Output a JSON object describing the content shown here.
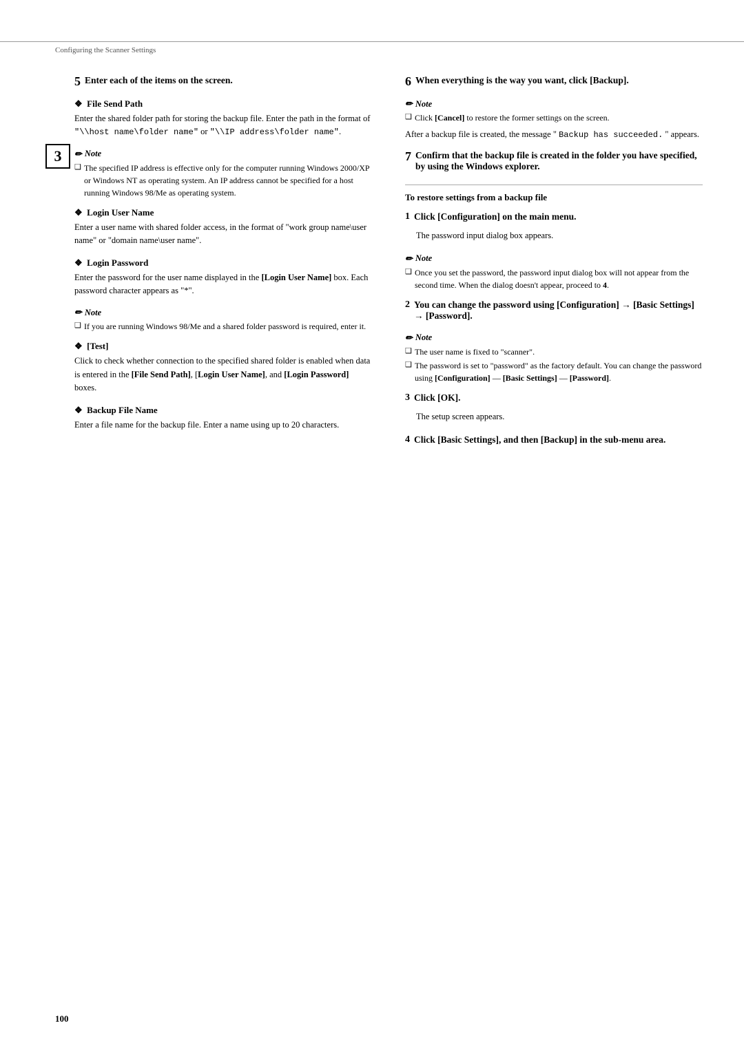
{
  "header": {
    "text": "Configuring the Scanner Settings"
  },
  "sidebar": {
    "chapter": "3"
  },
  "left_column": {
    "step5": {
      "label": "5",
      "text": "Enter each of the items on the screen."
    },
    "file_send_path": {
      "title": "❖  File Send Path",
      "body": "Enter the shared folder path for storing the backup file. Enter the path in the format of \"\\\\host name\\folder name\" or \"\\\\IP address\\folder name\"."
    },
    "note1": {
      "title": "Note",
      "item1": "The specified IP address is effective only for the computer running Windows 2000/XP or Windows NT as operating system. An IP address cannot be specified for a host running Windows 98/Me as operating system."
    },
    "login_user_name": {
      "title": "❖  Login User Name",
      "body": "Enter a user name with shared folder access, in the format of \"work group name\\user name\" or \"domain name\\user name\"."
    },
    "login_password": {
      "title": "❖  Login Password",
      "body1": "Enter the password for the user name displayed in the ",
      "body1_bold": "[Login User Name]",
      "body1_end": " box. Each password character appears as \"*\"."
    },
    "note2": {
      "title": "Note",
      "item1": "If you are running Windows 98/Me and a shared folder password is required, enter it."
    },
    "test": {
      "title": "❖  [Test]",
      "body1": "Click to check whether connection to the specified shared folder is enabled when data is entered in the ",
      "body1_bold1": "[File Send Path]",
      "body1_mid": ", ",
      "body1_bold2": "[Login User Name]",
      "body1_mid2": ", and ",
      "body1_bold3": "[Login Password]",
      "body1_end": " boxes."
    },
    "backup_file_name": {
      "title": "❖  Backup File Name",
      "body": "Enter a file name for the backup file. Enter a name using up to 20 characters."
    }
  },
  "right_column": {
    "step6": {
      "label": "6",
      "text": "When everything is the way you want, click [Backup]."
    },
    "note3": {
      "title": "Note",
      "item1_pre": "Click ",
      "item1_bold": "[Cancel]",
      "item1_end": " to restore the former settings on the screen.",
      "after": "After a backup file is created, the message \" ",
      "after_code": "Backup has succeeded.",
      "after_end": " \" appears."
    },
    "step7": {
      "label": "7",
      "text": "Confirm that the backup file is created in the folder you have specified, by using the Windows explorer."
    },
    "divider": true,
    "restore_header": "To restore settings from a backup file",
    "step_r1": {
      "label": "1",
      "text_bold": "Click [Configuration] on the main menu.",
      "body": "The password input dialog box appears."
    },
    "note4": {
      "title": "Note",
      "item1": "Once you set the password, the password input dialog box will not appear from the second time. When the dialog doesn't appear, proceed to ",
      "item1_bold": "4",
      "item1_end": "."
    },
    "step_r2": {
      "label": "2",
      "text_pre": "You can change the password using [Configuration] → [Basic Settings] → [Password]."
    },
    "note5": {
      "title": "Note",
      "item1": "The user name is fixed to \"scanner\".",
      "item2_pre": "The password is set to \"password\" as the factory default. You can change the password using ",
      "item2_bold1": "[Configuration]",
      "item2_mid": " — ",
      "item2_bold2": "[Basic Settings]",
      "item2_mid2": " — ",
      "item2_bold3": "[Password]",
      "item2_end": "."
    },
    "step_r3": {
      "label": "3",
      "text": "Click [OK].",
      "body": "The setup screen appears."
    },
    "step_r4": {
      "label": "4",
      "text": "Click [Basic Settings], and then [Backup] in the sub-menu area."
    }
  },
  "footer": {
    "page_number": "100"
  }
}
